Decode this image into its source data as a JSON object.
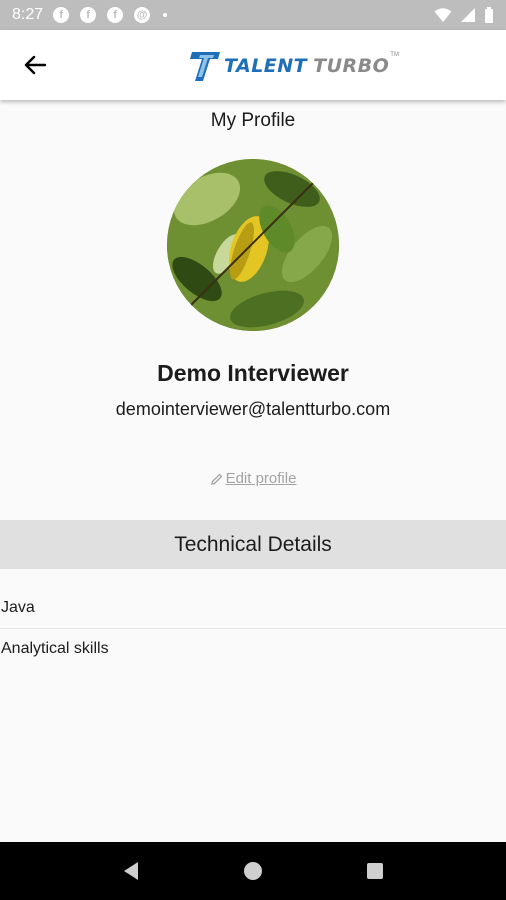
{
  "status_bar": {
    "time": "8:27",
    "notification_icons": [
      "facebook-icon",
      "facebook-icon",
      "facebook-icon",
      "at-sign-icon"
    ],
    "icons": [
      "wifi-icon",
      "signal-icon",
      "battery-icon"
    ]
  },
  "app_bar": {
    "logo": {
      "text_part1": "TALENT",
      "text_part2": "TURBO",
      "trademark": "TM",
      "primary_color": "#1e6fb8",
      "secondary_color": "#8a8a8a"
    },
    "back_icon": "arrow-left-icon"
  },
  "profile": {
    "title": "My Profile",
    "name": "Demo Interviewer",
    "email": "demointerviewer@talentturbo.com",
    "edit_label": "Edit profile",
    "edit_icon": "pencil-icon"
  },
  "technical": {
    "header": "Technical Details",
    "skills": [
      "Java",
      "Analytical skills"
    ]
  },
  "nav_bar": {
    "buttons": [
      "back-triangle-icon",
      "home-circle-icon",
      "recents-square-icon"
    ]
  },
  "colors": {
    "background": "#fafafa",
    "section_header": "#e0e0e0",
    "status_bar": "#bdbdbd",
    "muted_text": "#a3a3a3"
  }
}
